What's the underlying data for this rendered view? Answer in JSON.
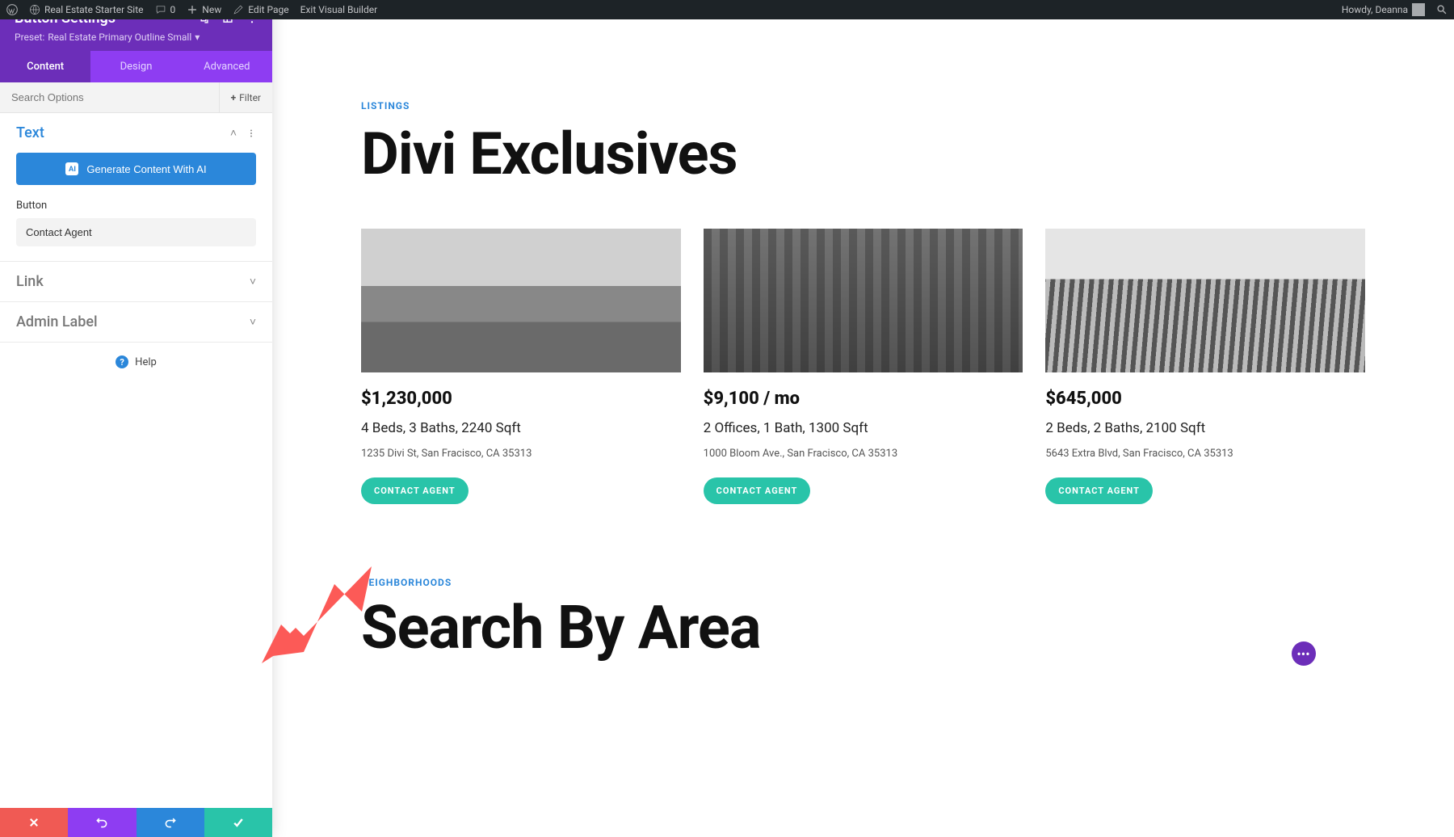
{
  "wpbar": {
    "site_name": "Real Estate Starter Site",
    "comments": "0",
    "new_label": "New",
    "edit_label": "Edit Page",
    "exit_label": "Exit Visual Builder",
    "howdy": "Howdy, Deanna"
  },
  "sidebar": {
    "title": "Button Settings",
    "preset_prefix": "Preset:",
    "preset_name": "Real Estate Primary Outline Small",
    "tabs": {
      "content": "Content",
      "design": "Design",
      "advanced": "Advanced"
    },
    "search_placeholder": "Search Options",
    "filter_label": "Filter",
    "text_section_title": "Text",
    "ai_button_label": "Generate Content With AI",
    "ai_badge": "AI",
    "field_button_label": "Button",
    "field_button_value": "Contact Agent",
    "link_section_title": "Link",
    "admin_section_title": "Admin Label",
    "help_label": "Help"
  },
  "page": {
    "listings_eyebrow": "LISTINGS",
    "listings_title": "Divi Exclusives",
    "cards": [
      {
        "price": "$1,230,000",
        "meta1": "4 Beds, 3 Baths, 2240 Sqft",
        "meta2": "1235 Divi St, San Fracisco, CA 35313",
        "cta": "CONTACT AGENT"
      },
      {
        "price": "$9,100 / mo",
        "meta1": "2 Offices, 1 Bath, 1300 Sqft",
        "meta2": "1000 Bloom Ave., San Fracisco, CA 35313",
        "cta": "CONTACT AGENT"
      },
      {
        "price": "$645,000",
        "meta1": "2 Beds, 2 Baths, 2100 Sqft",
        "meta2": "5643 Extra Blvd, San Fracisco, CA 35313",
        "cta": "CONTACT AGENT"
      }
    ],
    "neigh_eyebrow": "NEIGHBORHOODS",
    "neigh_title": "Search By Area"
  }
}
